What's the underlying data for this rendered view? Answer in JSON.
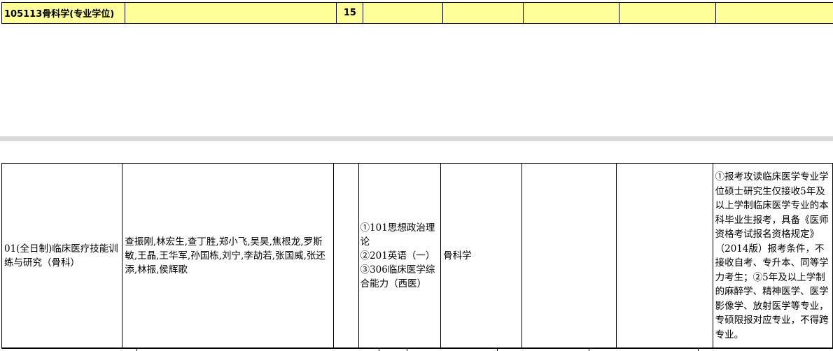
{
  "program_header": {
    "program": "105113骨科学(专业学位)",
    "enrollment": "15"
  },
  "direction_row": {
    "direction": "01(全日制)临床医疗技能训练与研究（骨科）",
    "supervisors": "查振刚,林宏生,查丁胜,郑小飞,吴昊,焦根龙,罗斯敏,王晶,王华军,孙国栋,刘宁,李劼若,张国威,张还添,林振,侯辉歌",
    "exam_1": "①101思想政治理论",
    "exam_2": "②201英语（一）",
    "exam_3": "③306临床医学综合能力（西医）",
    "retest_subject": "骨科学",
    "notes": "①报考攻读临床医学专业学位硕士研究生仅接收5年及以上学制临床医学专业的本科毕业生报考，具备《医师资格考试报名资格规定》（2014版）报考条件，不接收自考、专升本、同等学力考生；②5年及以上学制的麻醉学、精神医学、医学影像学、放射医学等专业，专硕限报对应专业，不得跨专业。"
  }
}
